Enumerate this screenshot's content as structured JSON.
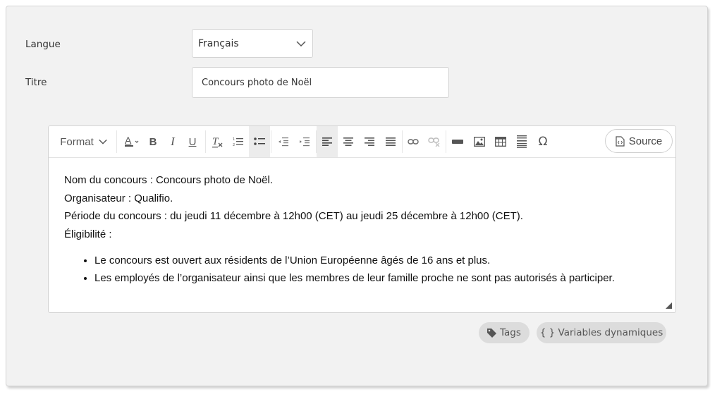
{
  "form": {
    "language_label": "Langue",
    "language_value": "Français",
    "title_label": "Titre",
    "title_value": "Concours photo de Noël"
  },
  "editor": {
    "format_label": "Format",
    "source_label": "Source",
    "toolbar_icons": [
      "text-color-icon",
      "bold-icon",
      "italic-icon",
      "underline-icon",
      "remove-format-icon",
      "numbered-list-icon",
      "bulleted-list-icon",
      "outdent-icon",
      "indent-icon",
      "align-left-icon",
      "align-center-icon",
      "align-right-icon",
      "justify-icon",
      "link-icon",
      "unlink-icon",
      "horizontal-rule-icon",
      "image-icon",
      "table-icon",
      "page-break-icon",
      "special-char-icon"
    ],
    "paragraphs": [
      "Nom du concours : Concours photo de Noël.",
      "Organisateur : Qualifio.",
      "Période du concours : du jeudi 11 décembre à 12h00 (CET) au jeudi 25 décembre à 12h00 (CET).",
      "Éligibilité :"
    ],
    "bullets": [
      "Le concours est ouvert aux résidents de l’Union Européenne âgés de 16 ans et plus.",
      "Les employés de l’organisateur ainsi que les membres de leur famille proche ne sont pas autorisés à participer."
    ]
  },
  "footer": {
    "tags_label": "Tags",
    "variables_label": "{ } Variables dynamiques"
  },
  "colors": {
    "card_bg": "#f2f2f2",
    "pill_bg": "#dcdcdc",
    "active_button_bg": "#ececec"
  }
}
